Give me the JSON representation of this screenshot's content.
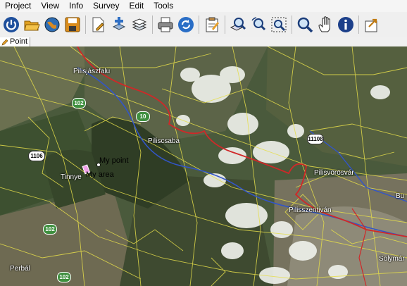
{
  "menu": [
    "Project",
    "View",
    "Info",
    "Survey",
    "Edit",
    "Tools"
  ],
  "toolbar": {
    "buttons": [
      "power-icon",
      "open-folder-icon",
      "globe-icon",
      "save-disk-icon",
      "edit-document-icon",
      "add-layer-icon",
      "layers-icon",
      "print-icon",
      "refresh-icon",
      "clipboard-icon",
      "zoom-layer-icon",
      "zoom-rotate-icon",
      "zoom-extent-icon",
      "zoom-icon",
      "pan-hand-icon",
      "info-icon",
      "export-icon"
    ]
  },
  "mode_tab": {
    "label": "Point"
  },
  "map": {
    "places": [
      "Pilisjászfalu",
      "Piliscsaba",
      "Pilisvörösvár",
      "Pilisszentiván",
      "Tinnye",
      "Perbál",
      "Solymár",
      "Bu"
    ],
    "roads": [
      "102",
      "10",
      "1106",
      "11108",
      "102",
      "102"
    ],
    "my_point": "My point",
    "my_area": "My area"
  },
  "colors": {
    "menubar": "#f5f5f5",
    "toolbar": "#efefef",
    "map_base": "#44503a",
    "vector_lines": "#e6de4a",
    "river": "#3255c8",
    "railway": "#d02828"
  }
}
